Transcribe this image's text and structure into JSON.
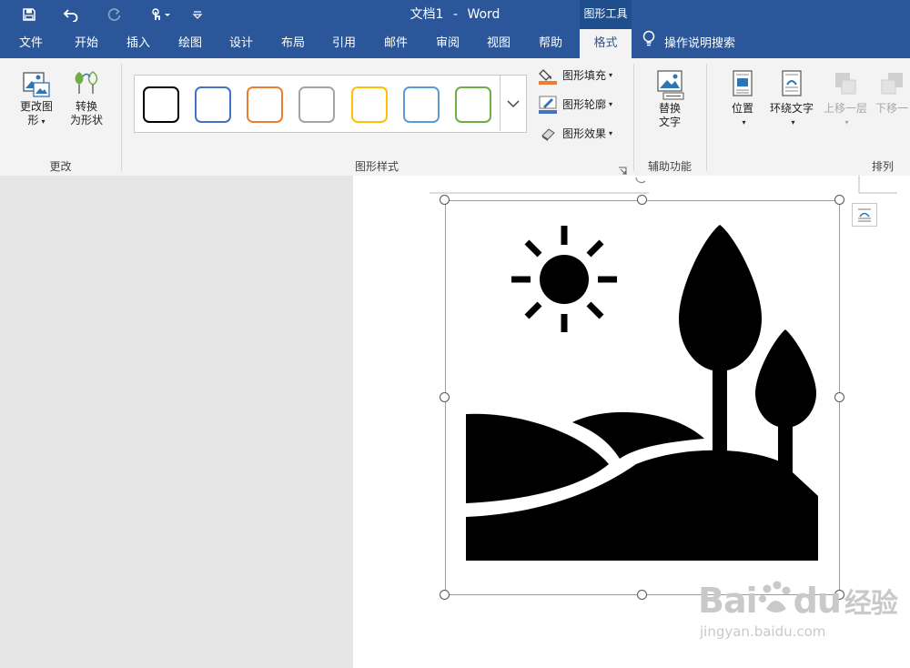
{
  "window": {
    "document_name": "文档1",
    "separator": "-",
    "app_name": "Word",
    "context_tab_group": "图形工具"
  },
  "quick_access": {
    "icons": [
      "save-icon",
      "undo-icon",
      "redo-icon",
      "touch-mode-icon",
      "customize-qat-icon"
    ]
  },
  "tabs": [
    {
      "label": "文件"
    },
    {
      "label": "开始"
    },
    {
      "label": "插入"
    },
    {
      "label": "绘图"
    },
    {
      "label": "设计"
    },
    {
      "label": "布局"
    },
    {
      "label": "引用"
    },
    {
      "label": "邮件"
    },
    {
      "label": "审阅"
    },
    {
      "label": "视图"
    },
    {
      "label": "帮助"
    },
    {
      "label": "格式",
      "active": true
    }
  ],
  "tell_me": {
    "label": "操作说明搜索",
    "icon": "lightbulb-icon"
  },
  "ribbon": {
    "change_group": {
      "label": "更改",
      "change_graphic_line1": "更改图",
      "change_graphic_line2": "形",
      "convert_line1": "转换",
      "convert_line2": "为形状"
    },
    "graphics_styles_group": {
      "label": "图形样式",
      "swatch_colors": [
        "#000000",
        "#4472c4",
        "#ed7d31",
        "#a5a5a5",
        "#ffc000",
        "#5b9bd5",
        "#70ad47"
      ],
      "fill_label": "图形填充",
      "outline_label": "图形轮廓",
      "effects_label": "图形效果",
      "fill_accent": "#ed7d31",
      "outline_accent": "#4472c4"
    },
    "accessibility_group": {
      "label": "辅助功能",
      "alt_text_line1": "替换",
      "alt_text_line2": "文字"
    },
    "arrange_group": {
      "label": "排列",
      "position_label": "位置",
      "wrap_text_label": "环绕文字",
      "bring_forward_label": "上移一层",
      "send_backward_label": "下移一"
    }
  },
  "watermark": {
    "brand": "Bai",
    "brand_end": "du",
    "cn": "经验",
    "url": "jingyan.baidu.com"
  },
  "colors": {
    "title_bar": "#2b579a",
    "ribbon_bg": "#f3f3f3",
    "page_bg": "#ffffff",
    "canvas_bg": "#e6e6e6"
  }
}
